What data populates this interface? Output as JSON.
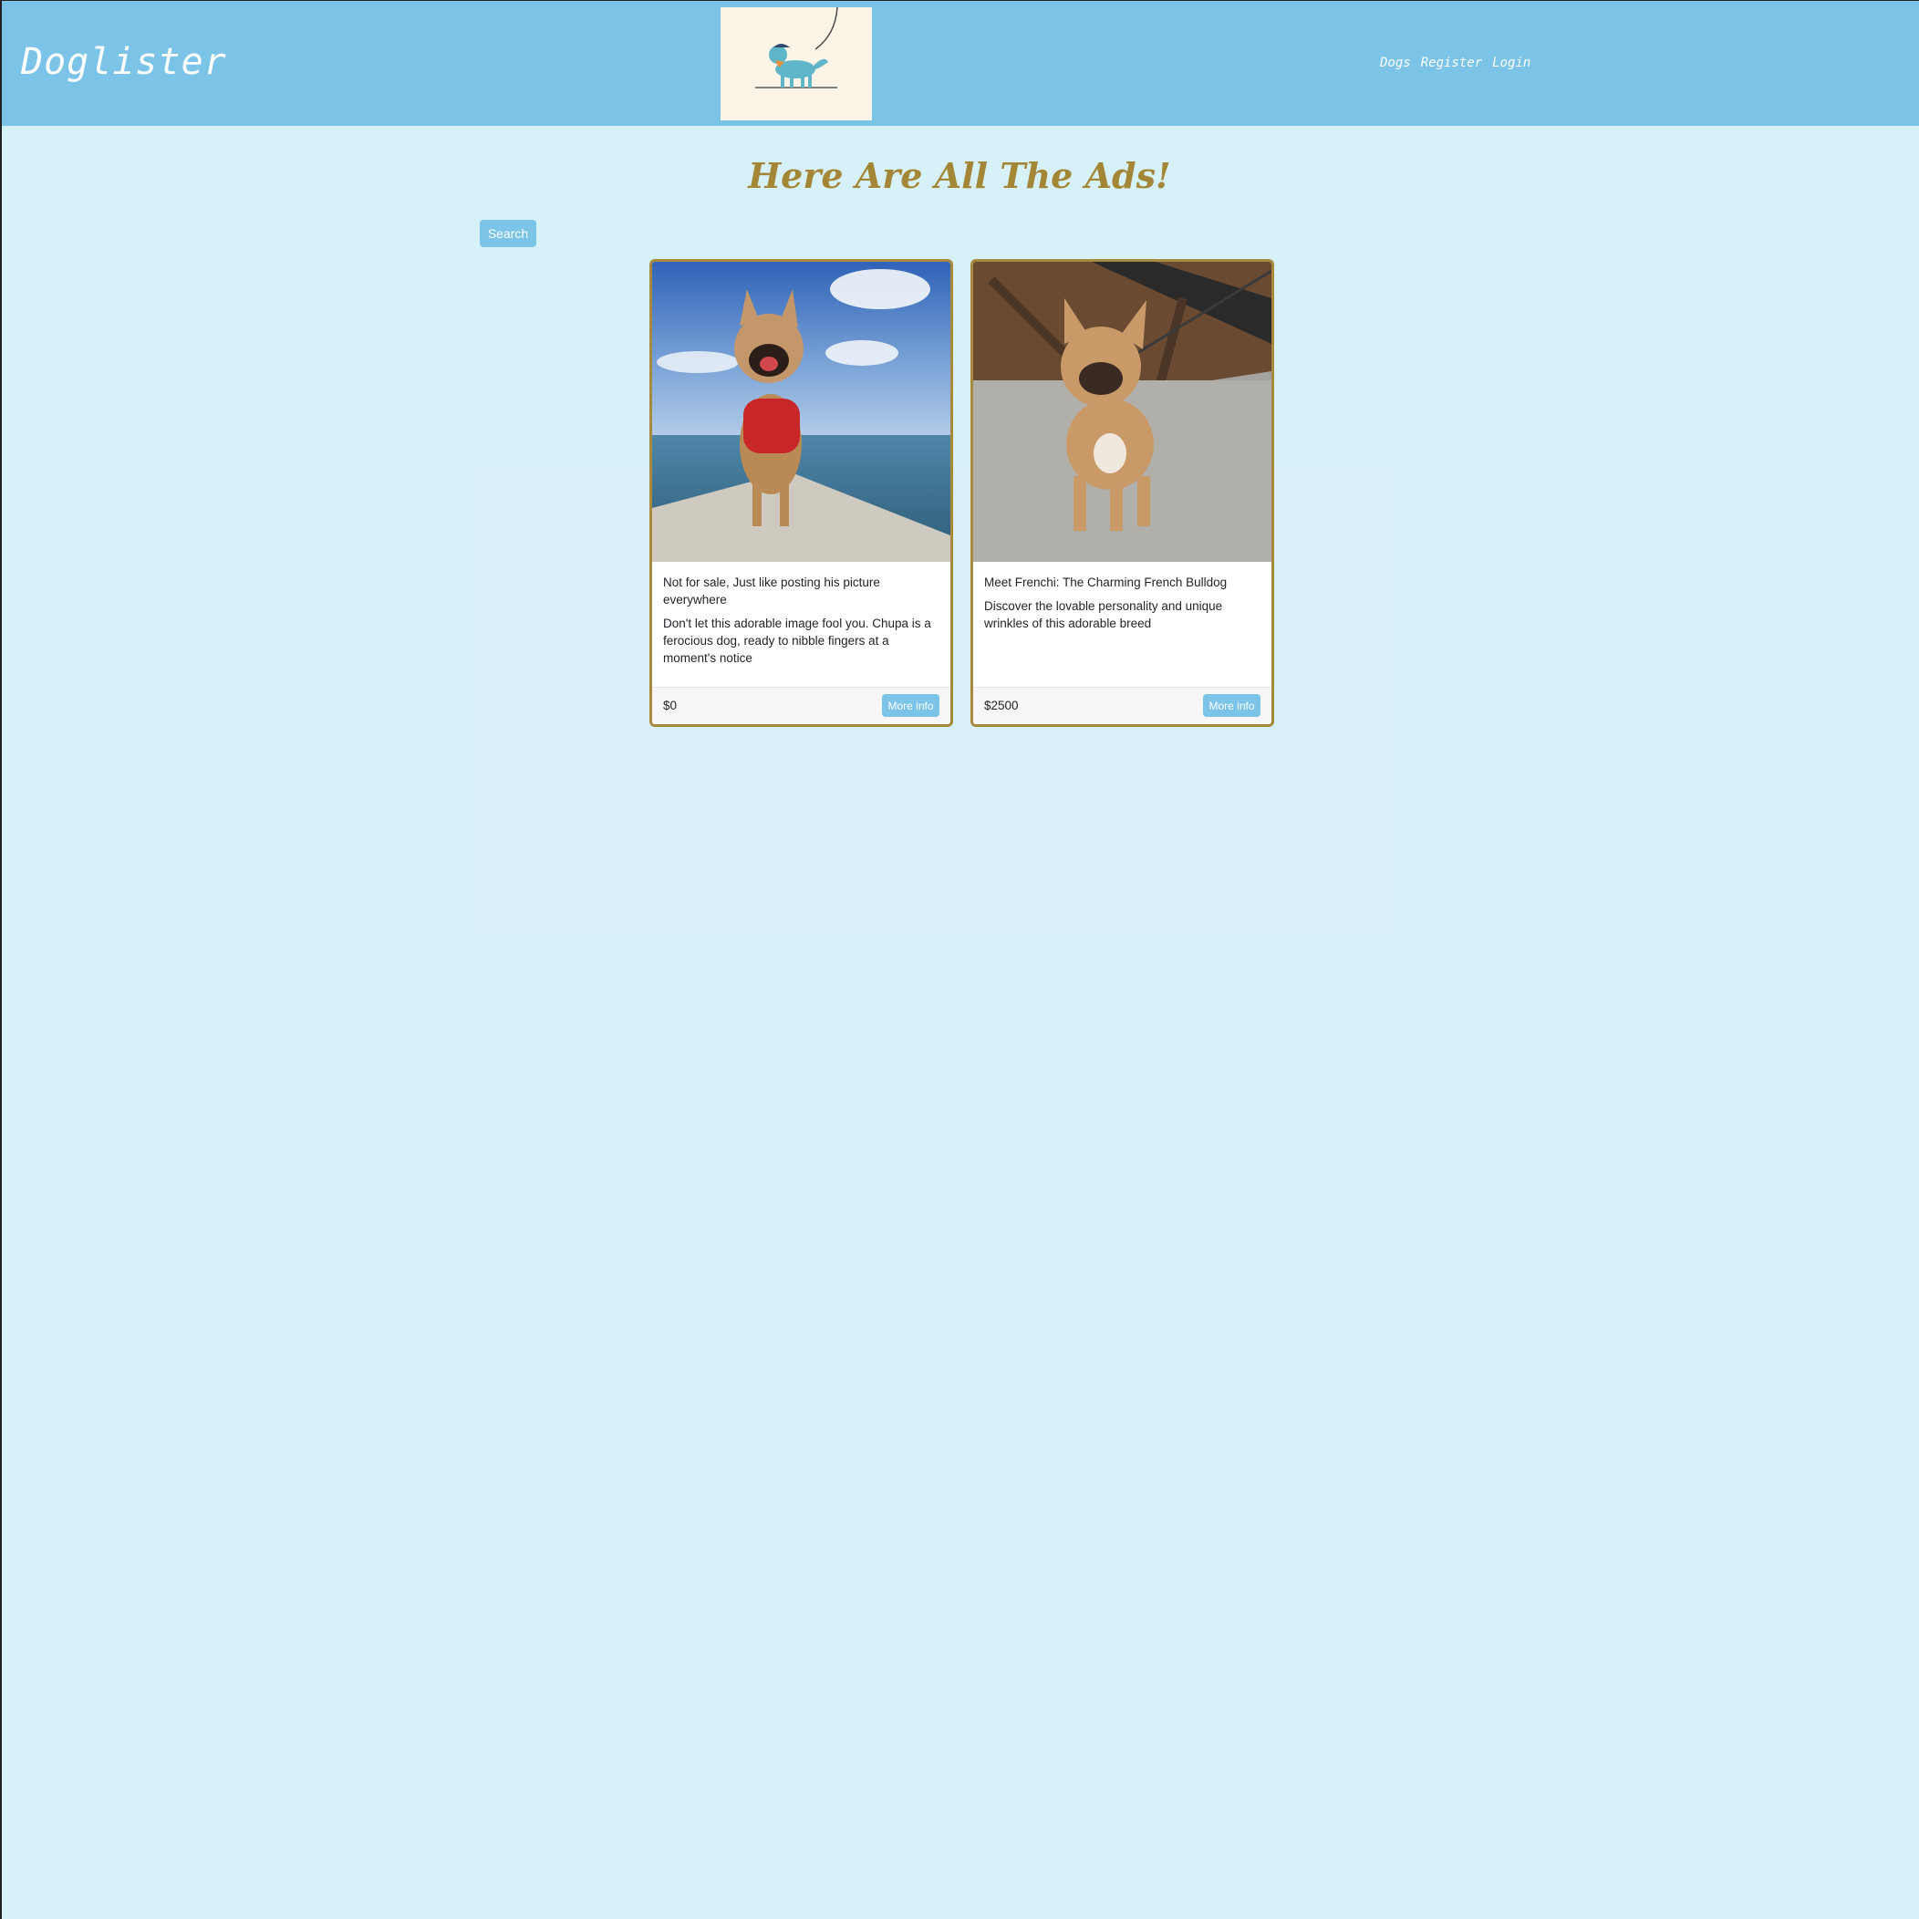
{
  "navbar": {
    "brand": "Doglister",
    "links": [
      "Dogs",
      "Register",
      "Login"
    ]
  },
  "heading": "Here Are All The Ads!",
  "search_label": "Search",
  "cards": [
    {
      "title": "Not for sale, Just like posting his picture everywhere",
      "description": "Don't let this adorable image fool you. Chupa is a ferocious dog, ready to nibble fingers at a moment's notice",
      "price": "$0",
      "button": "More info"
    },
    {
      "title": "Meet Frenchi: The Charming French Bulldog",
      "description": "Discover the lovable personality and unique wrinkles of this adorable breed",
      "price": "$2500",
      "button": "More info"
    }
  ],
  "colors": {
    "navbar": "#7bc4e8",
    "background": "#d7f1f9",
    "heading": "#a48637",
    "card_border": "#a88a3f"
  }
}
